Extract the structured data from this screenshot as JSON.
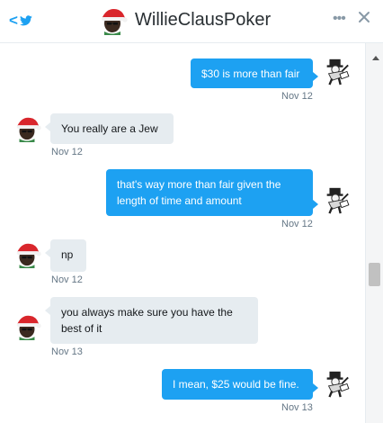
{
  "header": {
    "back_icon": "chevron-left-bird-icon",
    "title": "WillieClausPoker",
    "more_icon": "more-dots-icon",
    "more_label": "•••",
    "close_icon": "close-icon",
    "accent": "#1da1f2"
  },
  "messages": [
    {
      "direction": "out",
      "text": "$30 is more than fair",
      "timestamp": "Nov 12"
    },
    {
      "direction": "in",
      "text": "You really are a Jew",
      "timestamp": "Nov 12"
    },
    {
      "direction": "out",
      "text": "that's way more than fair given the length of time and amount",
      "timestamp": "Nov 12"
    },
    {
      "direction": "in",
      "text": "np",
      "timestamp": "Nov 12"
    },
    {
      "direction": "in",
      "text": "you always make sure you have the best of it",
      "timestamp": "Nov 13"
    },
    {
      "direction": "out",
      "text": "I mean, $25 would be fine.",
      "timestamp": "Nov 13"
    }
  ],
  "colors": {
    "outgoing_bubble": "#1da1f2",
    "incoming_bubble": "#e6ecf0",
    "timestamp": "#657786"
  }
}
